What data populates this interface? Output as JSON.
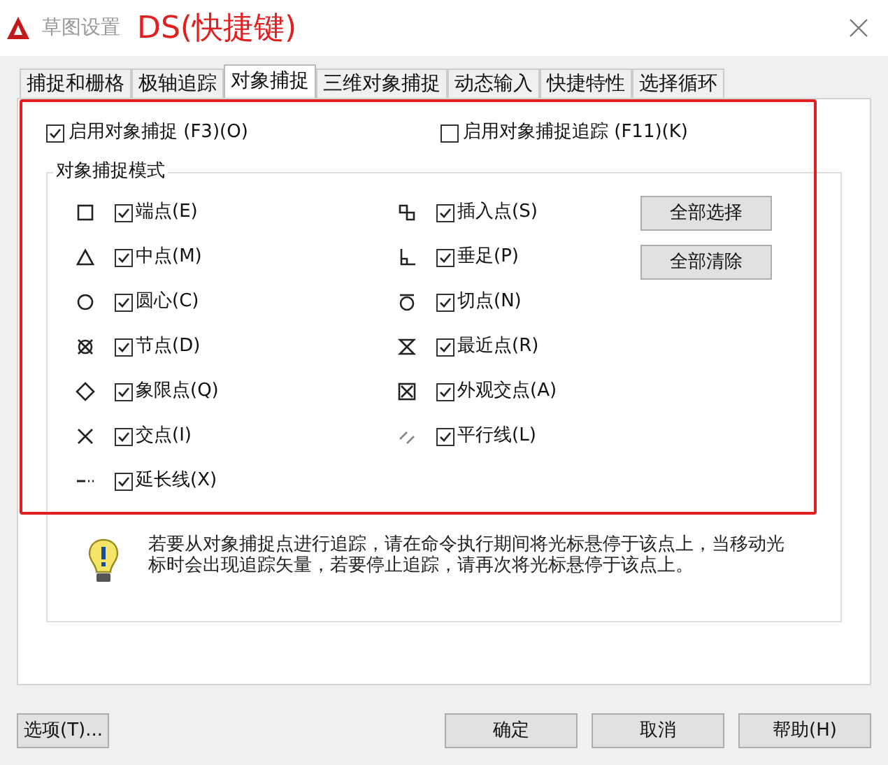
{
  "window": {
    "title": "草图设置",
    "annotation": "DS(快捷键)"
  },
  "tabs": [
    {
      "label": "捕捉和栅格",
      "selected": false
    },
    {
      "label": "极轴追踪",
      "selected": false
    },
    {
      "label": "对象捕捉",
      "selected": true
    },
    {
      "label": "三维对象捕捉",
      "selected": false
    },
    {
      "label": "动态输入",
      "selected": false
    },
    {
      "label": "快捷特性",
      "selected": false
    },
    {
      "label": "选择循环",
      "selected": false
    }
  ],
  "enable_snap": {
    "label": "启用对象捕捉 (F3)(O)",
    "checked": true
  },
  "enable_tracking": {
    "label": "启用对象捕捉追踪 (F11)(K)",
    "checked": false
  },
  "snap_modes": {
    "title": "对象捕捉模式",
    "left": [
      {
        "kind": "endpoint",
        "label": "端点(E)",
        "checked": true
      },
      {
        "kind": "midpoint",
        "label": "中点(M)",
        "checked": true
      },
      {
        "kind": "center",
        "label": "圆心(C)",
        "checked": true
      },
      {
        "kind": "node",
        "label": "节点(D)",
        "checked": true
      },
      {
        "kind": "quadrant",
        "label": "象限点(Q)",
        "checked": true
      },
      {
        "kind": "intersection",
        "label": "交点(I)",
        "checked": true
      },
      {
        "kind": "extension",
        "label": "延长线(X)",
        "checked": true
      }
    ],
    "right": [
      {
        "kind": "insertion",
        "label": "插入点(S)",
        "checked": true
      },
      {
        "kind": "perpendicular",
        "label": "垂足(P)",
        "checked": true
      },
      {
        "kind": "tangent",
        "label": "切点(N)",
        "checked": true
      },
      {
        "kind": "nearest",
        "label": "最近点(R)",
        "checked": true
      },
      {
        "kind": "apparent",
        "label": "外观交点(A)",
        "checked": true
      },
      {
        "kind": "parallel",
        "label": "平行线(L)",
        "checked": true
      }
    ],
    "buttons": [
      "全部选择",
      "全部清除"
    ]
  },
  "info": "若要从对象捕捉点进行追踪，请在命令执行期间将光标悬停于该点上，当移动光标时会出现追踪矢量，若要停止追踪，请再次将光标悬停于该点上。",
  "footer": {
    "options": "选项(T)...",
    "buttons": [
      "确定",
      "取消",
      "帮助(H)"
    ]
  }
}
